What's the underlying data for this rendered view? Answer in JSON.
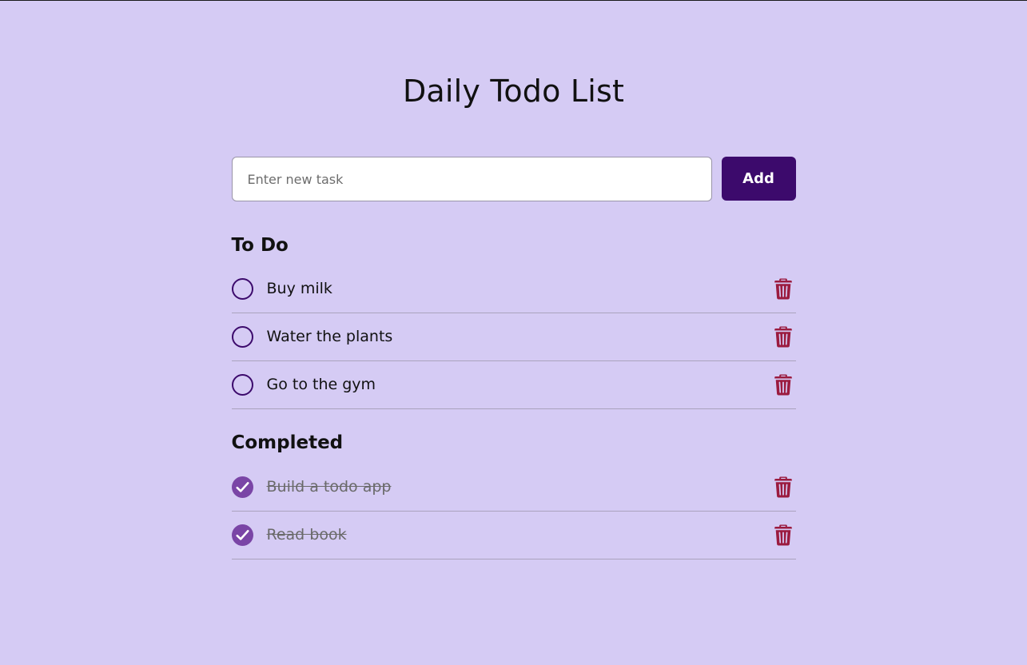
{
  "page": {
    "title": "Daily Todo List"
  },
  "add_form": {
    "placeholder": "Enter new task",
    "value": "",
    "button_label": "Add"
  },
  "sections": {
    "todo_title": "To Do",
    "completed_title": "Completed"
  },
  "todo_items": [
    {
      "text": "Buy milk",
      "completed": false
    },
    {
      "text": "Water the plants",
      "completed": false
    },
    {
      "text": "Go to the gym",
      "completed": false
    }
  ],
  "completed_items": [
    {
      "text": "Build a todo app",
      "completed": true
    },
    {
      "text": "Read book",
      "completed": true
    }
  ],
  "icons": {
    "checkbox_open": "circle-outline-icon",
    "checkbox_done": "check-circle-icon",
    "delete": "trash-icon"
  },
  "colors": {
    "background": "#d5cbf4",
    "accent": "#3c0a6c",
    "check_done": "#7a45a6",
    "delete": "#9b1b3f"
  }
}
